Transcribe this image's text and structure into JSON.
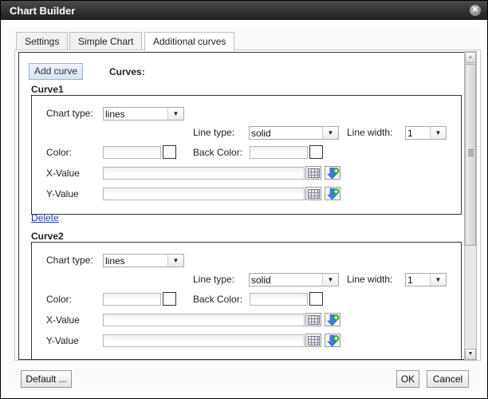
{
  "window": {
    "title": "Chart Builder",
    "close_icon": "close-icon"
  },
  "tabs": [
    {
      "label": "Settings",
      "active": false
    },
    {
      "label": "Simple Chart",
      "active": false
    },
    {
      "label": "Additional curves",
      "active": true
    }
  ],
  "panel": {
    "add_curve_label": "Add curve",
    "curves_label": "Curves:",
    "delete_label": "Delete",
    "curves": [
      {
        "title": "Curve1",
        "chart_type_label": "Chart type:",
        "chart_type_value": "lines",
        "line_type_label": "Line type:",
        "line_type_value": "solid",
        "line_width_label": "Line width:",
        "line_width_value": "1",
        "color_label": "Color:",
        "color_value": "",
        "back_color_label": "Back Color:",
        "back_color_value": "",
        "x_value_label": "X-Value",
        "x_value": "",
        "y_value_label": "Y-Value",
        "y_value": ""
      },
      {
        "title": "Curve2",
        "chart_type_label": "Chart type:",
        "chart_type_value": "lines",
        "line_type_label": "Line type:",
        "line_type_value": "solid",
        "line_width_label": "Line width:",
        "line_width_value": "1",
        "color_label": "Color:",
        "color_value": "",
        "back_color_label": "Back Color:",
        "back_color_value": "",
        "x_value_label": "X-Value",
        "x_value": "",
        "y_value_label": "Y-Value",
        "y_value": ""
      }
    ]
  },
  "footer": {
    "default_label": "Default ...",
    "ok_label": "OK",
    "cancel_label": "Cancel"
  },
  "colors": {
    "titlebar": "#2e2e2e",
    "link": "#1a3fb0",
    "add_curve_bg": "#dfe7f1"
  }
}
